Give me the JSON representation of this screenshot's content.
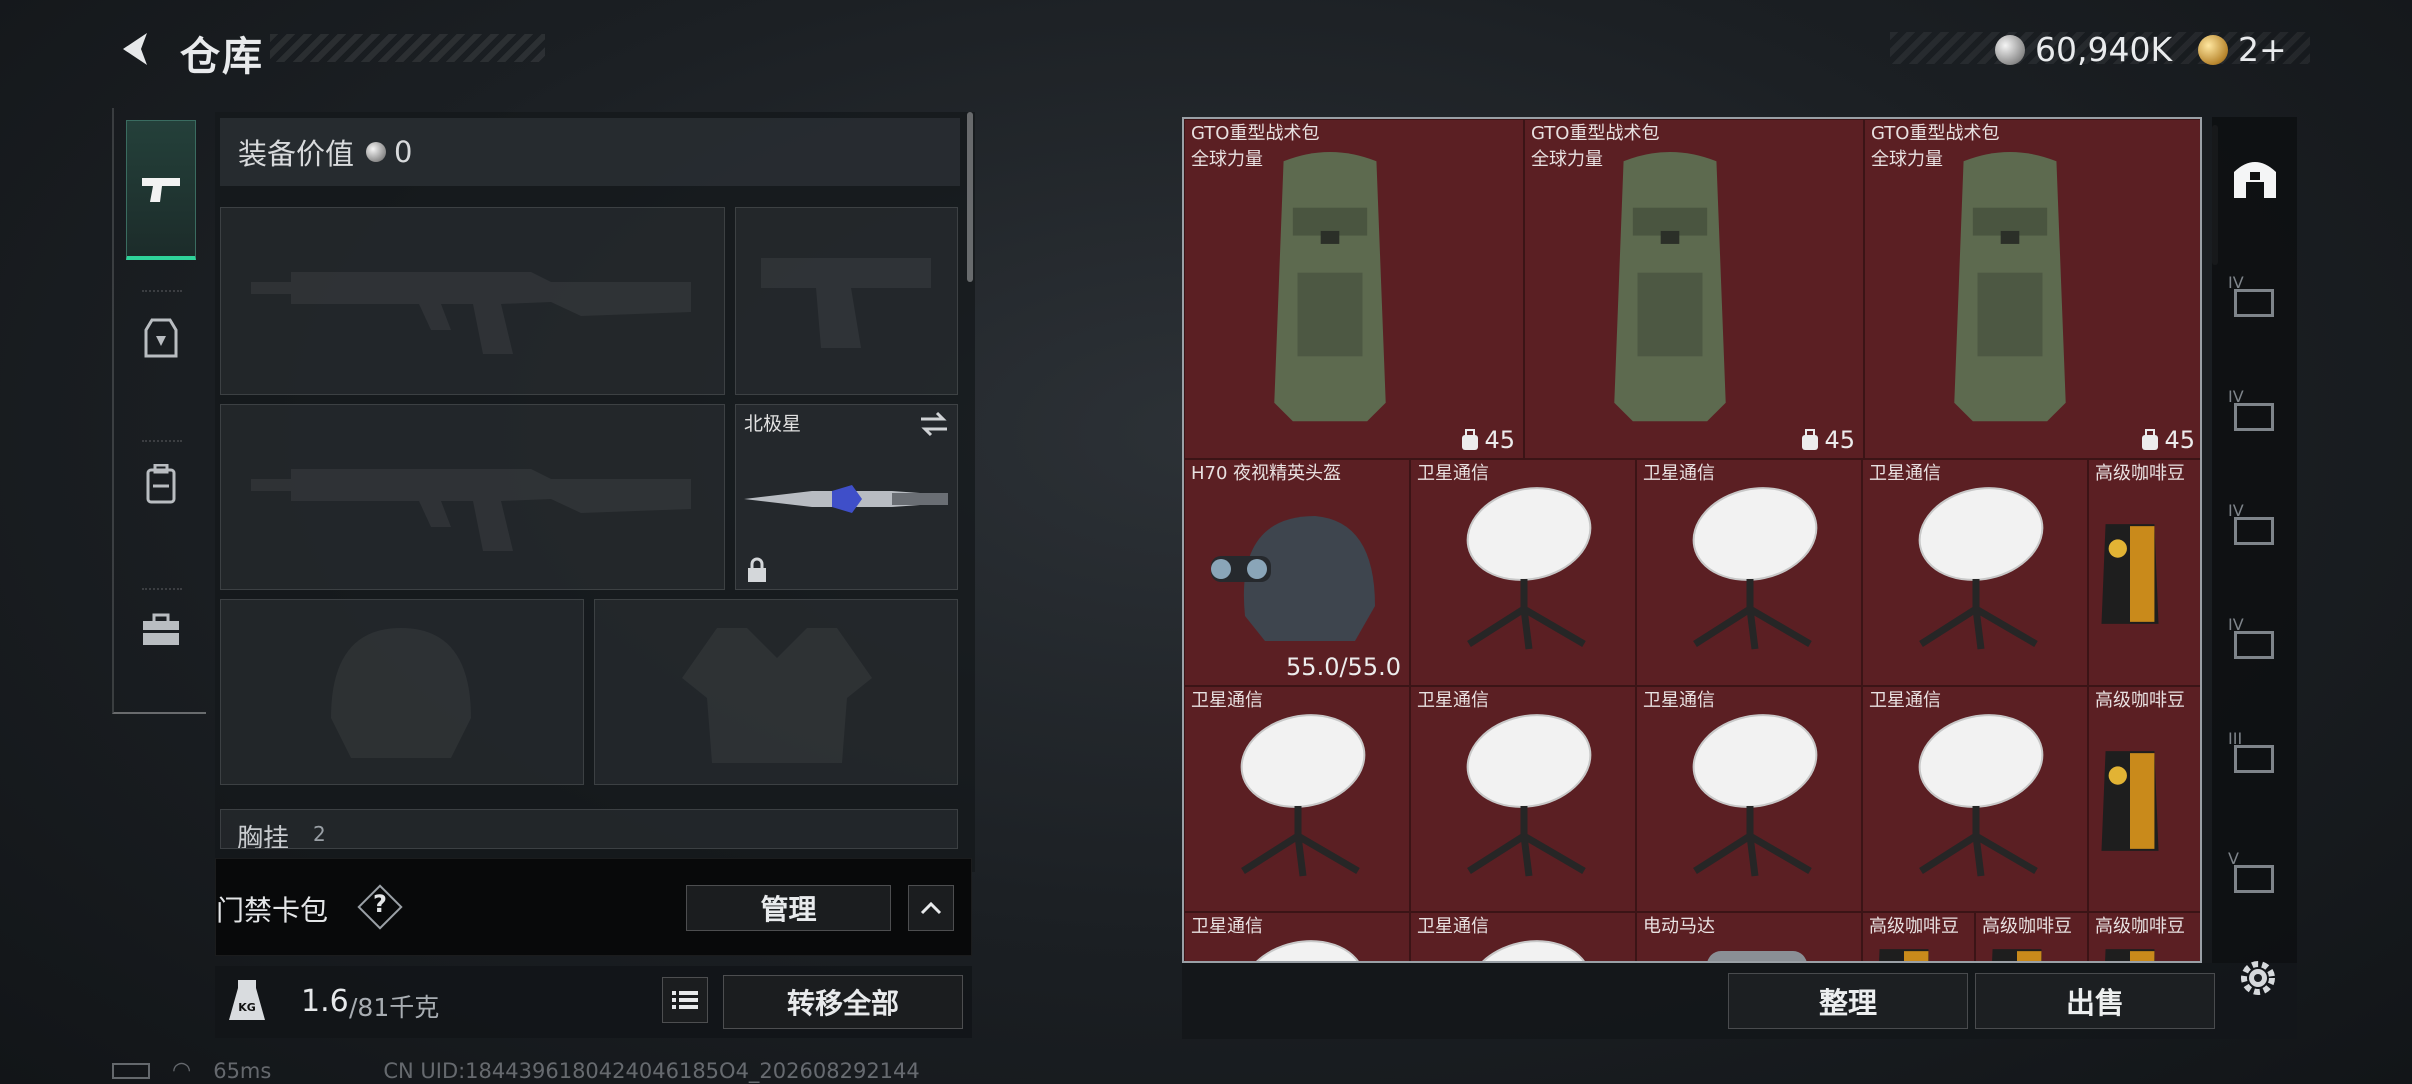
{
  "header": {
    "title": "仓库",
    "currency_amount": "60,940K",
    "premium_amount": "2+"
  },
  "loadout": {
    "equip_value_label": "装备价值",
    "equip_value": "0",
    "melee_slot_label": "北极星",
    "chest_label": "胸挂",
    "chest_badge": "2",
    "keycard_label": "门禁卡包",
    "keycard_help": "?",
    "manage_label": "管理",
    "weight_current": "1.6",
    "weight_max": "/81千克",
    "kg_icon_label": "KG",
    "transfer_all_label": "转移全部"
  },
  "stash": {
    "rows": [
      {
        "items": [
          {
            "title": "GTO重型战术包",
            "sub": "全球力量",
            "count": "45",
            "icon": "backpack-icon"
          },
          {
            "title": "GTO重型战术包",
            "sub": "全球力量",
            "count": "45",
            "icon": "backpack-icon"
          },
          {
            "title": "GTO重型战术包",
            "sub": "全球力量",
            "count": "45",
            "icon": "backpack-icon"
          }
        ]
      },
      {
        "items": [
          {
            "title": "H70 夜视精英头盔",
            "durability": "55.0/55.0",
            "icon": "helmet-icon"
          },
          {
            "title": "卫星通信",
            "icon": "satellite-dish-icon"
          },
          {
            "title": "卫星通信",
            "icon": "satellite-dish-icon"
          },
          {
            "title": "卫星通信",
            "icon": "satellite-dish-icon"
          },
          {
            "title": "高级咖啡豆",
            "icon": "coffee-bag-icon"
          }
        ]
      },
      {
        "items": [
          {
            "title": "卫星通信",
            "icon": "satellite-dish-icon"
          },
          {
            "title": "卫星通信",
            "icon": "satellite-dish-icon"
          },
          {
            "title": "卫星通信",
            "icon": "satellite-dish-icon"
          },
          {
            "title": "卫星通信",
            "icon": "satellite-dish-icon"
          },
          {
            "title": "高级咖啡豆",
            "icon": "coffee-bag-icon"
          }
        ]
      },
      {
        "items": [
          {
            "title": "卫星通信",
            "icon": "satellite-dish-icon"
          },
          {
            "title": "卫星通信",
            "icon": "satellite-dish-icon"
          },
          {
            "title": "电动马达",
            "icon": "motor-icon"
          },
          {
            "title": "高级咖啡豆",
            "icon": "coffee-bag-icon"
          },
          {
            "title": "高级咖啡豆",
            "icon": "coffee-bag-icon"
          },
          {
            "title": "高级咖啡豆",
            "icon": "coffee-bag-icon"
          }
        ]
      }
    ],
    "sort_label": "整理",
    "sell_label": "出售"
  },
  "right_tabs": [
    {
      "icon": "stash-home-icon",
      "tier": ""
    },
    {
      "icon": "container-tier-icon",
      "tier": "IV"
    },
    {
      "icon": "container-tier-icon",
      "tier": "IV"
    },
    {
      "icon": "container-tier-icon",
      "tier": "IV"
    },
    {
      "icon": "container-tier-icon",
      "tier": "IV"
    },
    {
      "icon": "container-tier-icon",
      "tier": "III"
    },
    {
      "icon": "container-tier-icon",
      "tier": "V"
    }
  ],
  "footer": {
    "ping": "65ms",
    "uid": "CN UID:1844396180424046185O4_202608292144"
  },
  "colors": {
    "accent_green": "#2fd39a",
    "stash_red": "#5b1f23"
  }
}
